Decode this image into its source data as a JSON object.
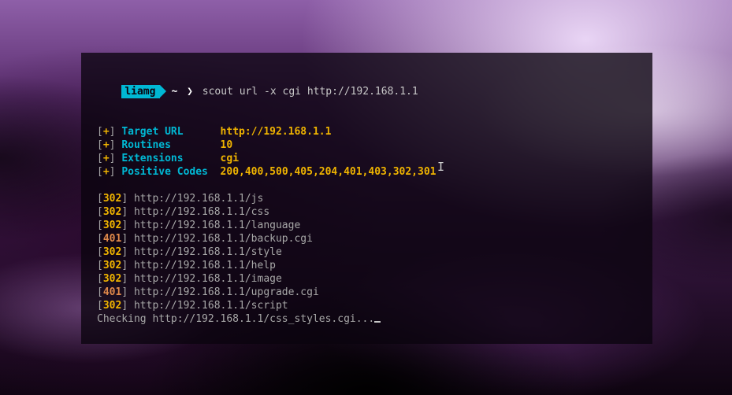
{
  "prompt": {
    "user": "liamg",
    "path": "~",
    "chevron": "❯",
    "command": "scout url -x cgi http://192.168.1.1"
  },
  "info": [
    {
      "label": "Target URL",
      "value": "http://192.168.1.1"
    },
    {
      "label": "Routines",
      "value": "10"
    },
    {
      "label": "Extensions",
      "value": "cgi"
    },
    {
      "label": "Positive Codes",
      "value": "200,400,500,405,204,401,403,302,301"
    }
  ],
  "results": [
    {
      "code": "302",
      "codeClass": "code302",
      "url": "http://192.168.1.1/js"
    },
    {
      "code": "302",
      "codeClass": "code302",
      "url": "http://192.168.1.1/css"
    },
    {
      "code": "302",
      "codeClass": "code302",
      "url": "http://192.168.1.1/language"
    },
    {
      "code": "401",
      "codeClass": "code401",
      "url": "http://192.168.1.1/backup.cgi"
    },
    {
      "code": "302",
      "codeClass": "code302",
      "url": "http://192.168.1.1/style"
    },
    {
      "code": "302",
      "codeClass": "code302",
      "url": "http://192.168.1.1/help"
    },
    {
      "code": "302",
      "codeClass": "code302",
      "url": "http://192.168.1.1/image"
    },
    {
      "code": "401",
      "codeClass": "code401",
      "url": "http://192.168.1.1/upgrade.cgi"
    },
    {
      "code": "302",
      "codeClass": "code302",
      "url": "http://192.168.1.1/script"
    }
  ],
  "status": "Checking http://192.168.1.1/css_styles.cgi..."
}
